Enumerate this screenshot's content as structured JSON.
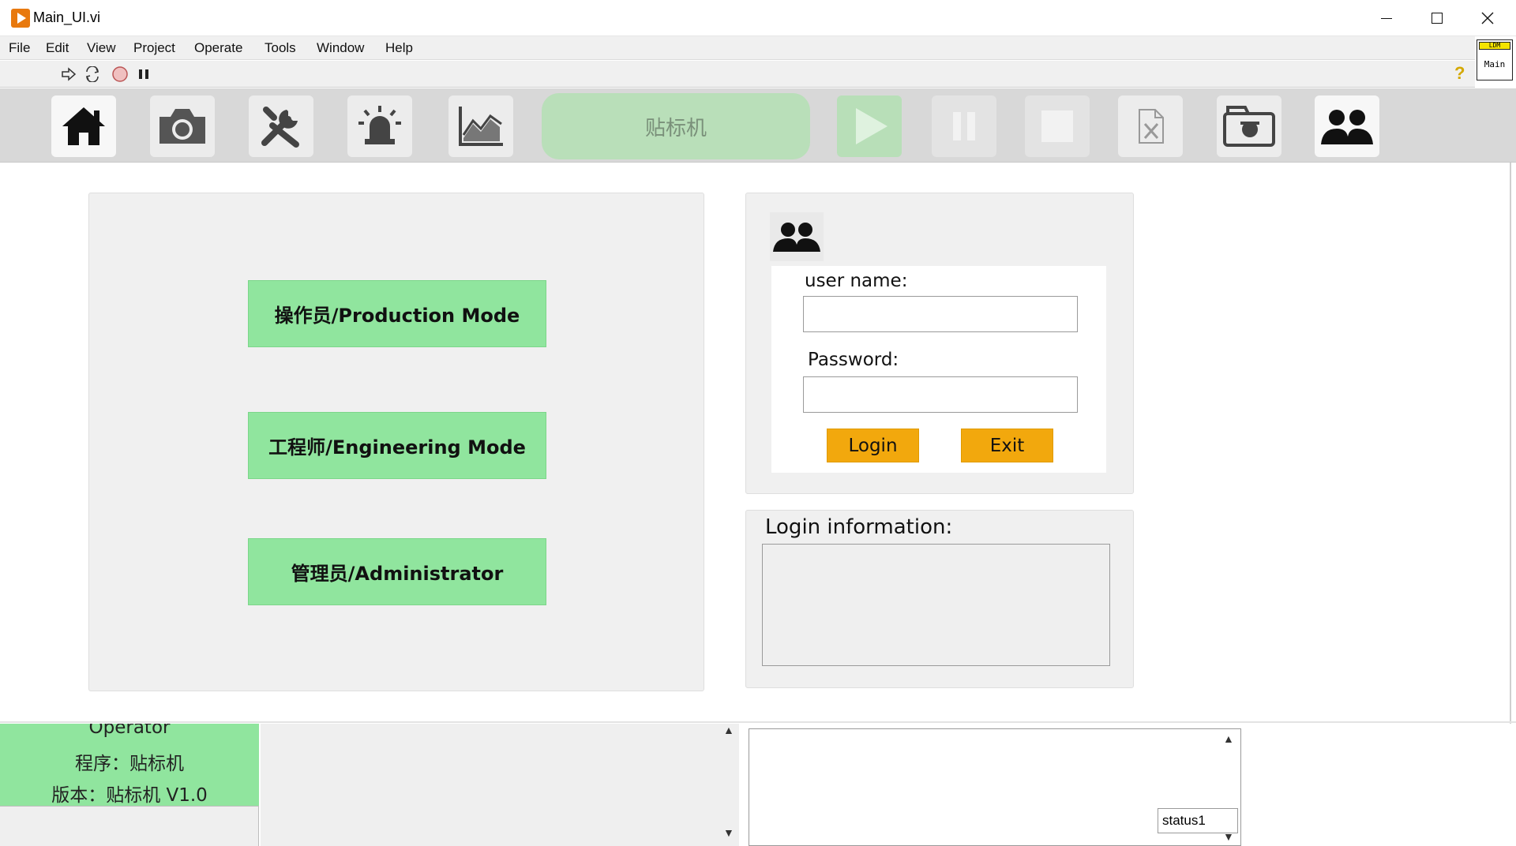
{
  "window": {
    "title": "Main_UI.vi"
  },
  "menu": [
    "File",
    "Edit",
    "View",
    "Project",
    "Operate",
    "Tools",
    "Window",
    "Help"
  ],
  "vi_icon": {
    "top": "LDM",
    "label": "Main"
  },
  "ribbon": {
    "machine_label": "贴标机",
    "icons": [
      "home-icon",
      "camera-icon",
      "tools-icon",
      "alarm-icon",
      "chart-icon",
      "play-icon",
      "pause-icon",
      "stop-icon",
      "excel-file-icon",
      "snapshot-icon",
      "users-icon"
    ]
  },
  "modes": {
    "production": "操作员/Production Mode",
    "engineering": "工程师/Engineering Mode",
    "administrator": "管理员/Administrator"
  },
  "login": {
    "username_label": "user name:",
    "password_label": "Password:",
    "username_value": "",
    "password_value": "",
    "login_button": "Login",
    "exit_button": "Exit"
  },
  "info": {
    "title": "Login information:",
    "content": ""
  },
  "status": {
    "role": "Operator",
    "program": "程序：贴标机",
    "version": "版本：贴标机 V1.0",
    "tag": "status1"
  },
  "colors": {
    "mode_green": "#90e59e",
    "login_yellow": "#f2a80d",
    "ribbon_gray": "#d8d8d8"
  }
}
